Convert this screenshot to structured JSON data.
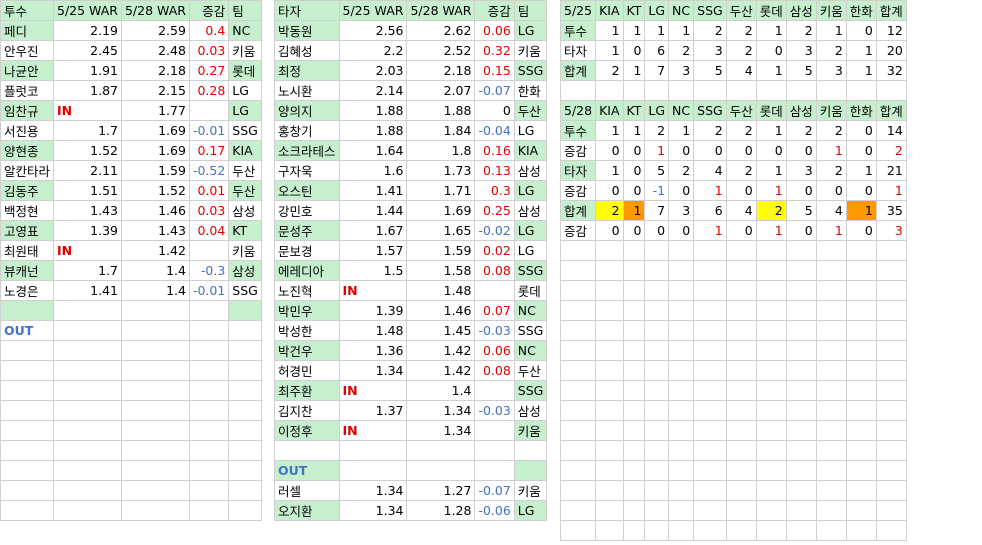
{
  "pitchers": {
    "headers": [
      "투수",
      "5/25 WAR",
      "5/28 WAR",
      "증감",
      "팀"
    ],
    "rows": [
      [
        "페디",
        "2.19",
        "2.59",
        "0.4",
        "NC"
      ],
      [
        "안우진",
        "2.45",
        "2.48",
        "0.03",
        "키움"
      ],
      [
        "나균안",
        "1.91",
        "2.18",
        "0.27",
        "롯데"
      ],
      [
        "플럿코",
        "1.87",
        "2.15",
        "0.28",
        "LG"
      ],
      [
        "임찬규",
        "IN",
        "1.77",
        "",
        "LG"
      ],
      [
        "서진용",
        "1.7",
        "1.69",
        "-0.01",
        "SSG"
      ],
      [
        "양현종",
        "1.52",
        "1.69",
        "0.17",
        "KIA"
      ],
      [
        "알칸타라",
        "2.11",
        "1.59",
        "-0.52",
        "두산"
      ],
      [
        "김동주",
        "1.51",
        "1.52",
        "0.01",
        "두산"
      ],
      [
        "백정현",
        "1.43",
        "1.46",
        "0.03",
        "삼성"
      ],
      [
        "고영표",
        "1.39",
        "1.43",
        "0.04",
        "KT"
      ],
      [
        "최원태",
        "IN",
        "1.42",
        "",
        "키움"
      ],
      [
        "뷰캐넌",
        "1.7",
        "1.4",
        "-0.3",
        "삼성"
      ],
      [
        "노경은",
        "1.41",
        "1.4",
        "-0.01",
        "SSG"
      ],
      [
        "",
        "",
        "",
        "",
        ""
      ],
      [
        "OUT",
        "",
        "",
        "",
        ""
      ]
    ]
  },
  "batters": {
    "headers": [
      "타자",
      "5/25 WAR",
      "5/28 WAR",
      "증감",
      "팀"
    ],
    "rows": [
      [
        "박동원",
        "2.56",
        "2.62",
        "0.06",
        "LG"
      ],
      [
        "김혜성",
        "2.2",
        "2.52",
        "0.32",
        "키움"
      ],
      [
        "최정",
        "2.03",
        "2.18",
        "0.15",
        "SSG"
      ],
      [
        "노시환",
        "2.14",
        "2.07",
        "-0.07",
        "한화"
      ],
      [
        "양의지",
        "1.88",
        "1.88",
        "0",
        "두산"
      ],
      [
        "홍창기",
        "1.88",
        "1.84",
        "-0.04",
        "LG"
      ],
      [
        "소크라테스",
        "1.64",
        "1.8",
        "0.16",
        "KIA"
      ],
      [
        "구자욱",
        "1.6",
        "1.73",
        "0.13",
        "삼성"
      ],
      [
        "오스틴",
        "1.41",
        "1.71",
        "0.3",
        "LG"
      ],
      [
        "강민호",
        "1.44",
        "1.69",
        "0.25",
        "삼성"
      ],
      [
        "문성주",
        "1.67",
        "1.65",
        "-0.02",
        "LG"
      ],
      [
        "문보경",
        "1.57",
        "1.59",
        "0.02",
        "LG"
      ],
      [
        "에레디아",
        "1.5",
        "1.58",
        "0.08",
        "SSG"
      ],
      [
        "노진혁",
        "IN",
        "1.48",
        "",
        "롯데"
      ],
      [
        "박민우",
        "1.39",
        "1.46",
        "0.07",
        "NC"
      ],
      [
        "박성한",
        "1.48",
        "1.45",
        "-0.03",
        "SSG"
      ],
      [
        "박건우",
        "1.36",
        "1.42",
        "0.06",
        "NC"
      ],
      [
        "허경민",
        "1.34",
        "1.42",
        "0.08",
        "두산"
      ],
      [
        "최주환",
        "IN",
        "1.4",
        "",
        "SSG"
      ],
      [
        "김지찬",
        "1.37",
        "1.34",
        "-0.03",
        "삼성"
      ],
      [
        "이정후",
        "IN",
        "1.34",
        "",
        "키움"
      ],
      [
        "",
        "",
        "",
        "",
        ""
      ],
      [
        "OUT",
        "",
        "",
        "",
        ""
      ],
      [
        "러셀",
        "1.34",
        "1.27",
        "-0.07",
        "키움"
      ],
      [
        "오지환",
        "1.34",
        "1.28",
        "-0.06",
        "LG"
      ]
    ]
  },
  "summary": {
    "headers_525": [
      "5/25",
      "KIA",
      "KT",
      "LG",
      "NC",
      "SSG",
      "두산",
      "롯데",
      "삼성",
      "키움",
      "한화",
      "합계"
    ],
    "rows_525": [
      [
        "투수",
        "1",
        "1",
        "1",
        "1",
        "2",
        "2",
        "1",
        "2",
        "1",
        "0",
        "12"
      ],
      [
        "타자",
        "1",
        "0",
        "6",
        "2",
        "3",
        "2",
        "0",
        "3",
        "2",
        "1",
        "20"
      ],
      [
        "합계",
        "2",
        "1",
        "7",
        "3",
        "5",
        "4",
        "1",
        "5",
        "3",
        "1",
        "32"
      ]
    ],
    "headers_528": [
      "5/28",
      "KIA",
      "KT",
      "LG",
      "NC",
      "SSG",
      "두산",
      "롯데",
      "삼성",
      "키움",
      "한화",
      "합계"
    ],
    "rows_528": [
      [
        "투수",
        "1",
        "1",
        "2",
        "1",
        "2",
        "2",
        "1",
        "2",
        "2",
        "0",
        "14"
      ],
      [
        "증감",
        "0",
        "0",
        "1",
        "0",
        "0",
        "0",
        "0",
        "0",
        "1",
        "0",
        "2"
      ],
      [
        "타자",
        "1",
        "0",
        "5",
        "2",
        "4",
        "2",
        "1",
        "3",
        "2",
        "1",
        "21"
      ],
      [
        "증감",
        "0",
        "0",
        "-1",
        "0",
        "1",
        "0",
        "1",
        "0",
        "0",
        "0",
        "1"
      ],
      [
        "합계",
        "2",
        "1",
        "7",
        "3",
        "6",
        "4",
        "2",
        "5",
        "4",
        "1",
        "35"
      ],
      [
        "증감",
        "0",
        "0",
        "0",
        "0",
        "1",
        "0",
        "1",
        "0",
        "1",
        "0",
        "3"
      ]
    ]
  },
  "colors": {
    "header_bg": "#c6efce",
    "positive": "#e00000",
    "negative": "#4472c4",
    "highlight_yellow": "#ffff00",
    "highlight_orange": "#ff9900"
  }
}
